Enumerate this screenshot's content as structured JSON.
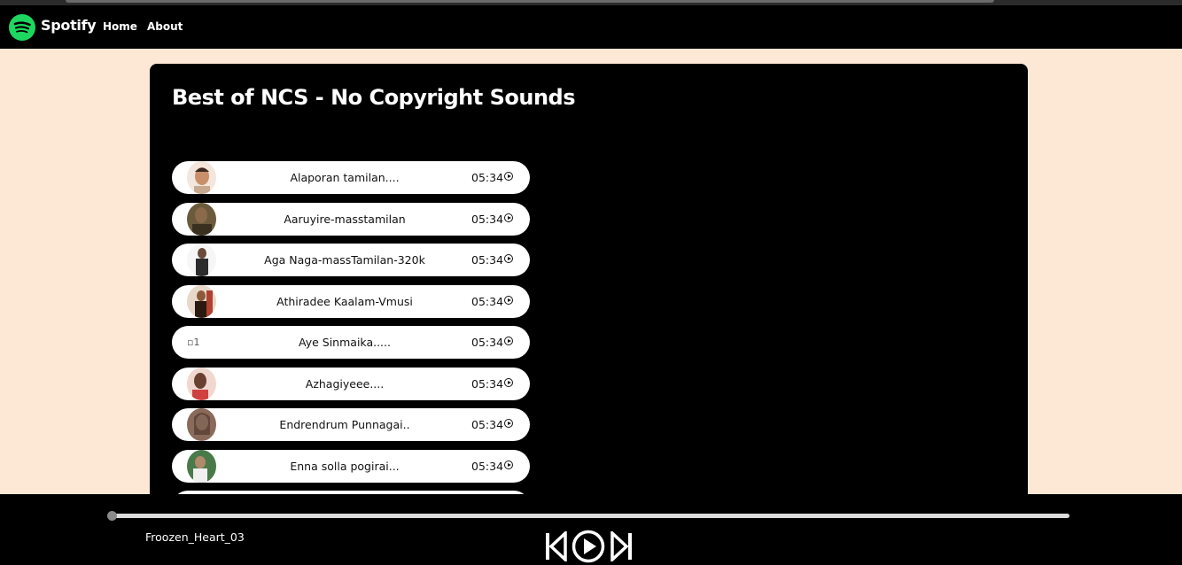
{
  "nav": {
    "brand": "Spotify",
    "links": [
      "Home",
      "About"
    ],
    "brand_color": "#1ed760"
  },
  "playlist": {
    "title": "Best of NCS - No Copyright Sounds",
    "songs": [
      {
        "title": "Alaporan tamilan....",
        "duration": "05:34",
        "avatar_color": "#c98f6a"
      },
      {
        "title": "Aaruyire-masstamilan",
        "duration": "05:34",
        "avatar_color": "#4a3a2a"
      },
      {
        "title": "Aga Naga-massTamilan-320k",
        "duration": "05:34",
        "avatar_color": "#2c2c2c"
      },
      {
        "title": "Athiradee Kaalam-Vmusi",
        "duration": "05:34",
        "avatar_color": "#8a5a3a"
      },
      {
        "title": "Aye Sinmaika.....",
        "duration": "05:34",
        "avatar_alt": "1"
      },
      {
        "title": "Azhagiyeee....",
        "duration": "05:34",
        "avatar_color": "#b06a5a"
      },
      {
        "title": "Endrendrum Punnagai..",
        "duration": "05:34",
        "avatar_color": "#9a7060"
      },
      {
        "title": "Enna solla pogirai...",
        "duration": "05:34",
        "avatar_color": "#3e6b3a"
      }
    ]
  },
  "player": {
    "now_playing": "Froozen_Heart_03",
    "progress": 0,
    "controls": [
      "previous-icon",
      "play-icon",
      "next-icon"
    ]
  }
}
